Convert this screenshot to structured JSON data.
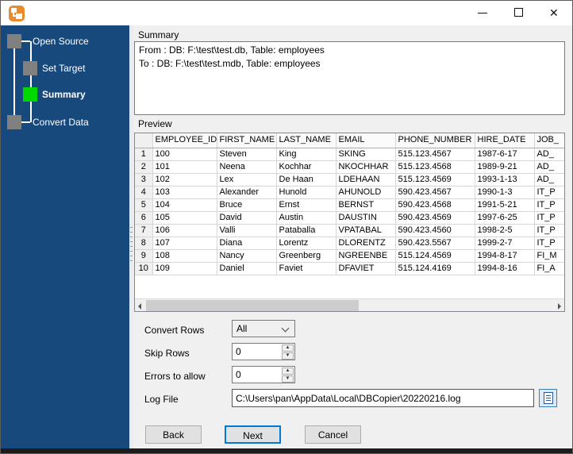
{
  "window": {
    "app_icon": "dbcopier-logo",
    "controls": {
      "minimize": "minimize",
      "maximize": "maximize",
      "close": "close"
    }
  },
  "sidebar": {
    "steps": [
      {
        "label": "Open Source",
        "state": "done"
      },
      {
        "label": "Set Target",
        "state": "done"
      },
      {
        "label": "Summary",
        "state": "active"
      },
      {
        "label": "Convert Data",
        "state": "pending"
      }
    ]
  },
  "main": {
    "summary": {
      "label": "Summary",
      "lines": [
        "From : DB: F:\\test\\test.db, Table: employees",
        "To : DB: F:\\test\\test.mdb, Table: employees"
      ]
    },
    "preview": {
      "label": "Preview",
      "columns": [
        "",
        "EMPLOYEE_ID",
        "FIRST_NAME",
        "LAST_NAME",
        "EMAIL",
        "PHONE_NUMBER",
        "HIRE_DATE",
        "JOB_"
      ],
      "rows": [
        [
          "1",
          "100",
          "Steven",
          "King",
          "SKING",
          "515.123.4567",
          "1987-6-17",
          "AD_"
        ],
        [
          "2",
          "101",
          "Neena",
          "Kochhar",
          "NKOCHHAR",
          "515.123.4568",
          "1989-9-21",
          "AD_"
        ],
        [
          "3",
          "102",
          "Lex",
          "De Haan",
          "LDEHAAN",
          "515.123.4569",
          "1993-1-13",
          "AD_"
        ],
        [
          "4",
          "103",
          "Alexander",
          "Hunold",
          "AHUNOLD",
          "590.423.4567",
          "1990-1-3",
          "IT_P"
        ],
        [
          "5",
          "104",
          "Bruce",
          "Ernst",
          "BERNST",
          "590.423.4568",
          "1991-5-21",
          "IT_P"
        ],
        [
          "6",
          "105",
          "David",
          "Austin",
          "DAUSTIN",
          "590.423.4569",
          "1997-6-25",
          "IT_P"
        ],
        [
          "7",
          "106",
          "Valli",
          "Pataballa",
          "VPATABAL",
          "590.423.4560",
          "1998-2-5",
          "IT_P"
        ],
        [
          "8",
          "107",
          "Diana",
          "Lorentz",
          "DLORENTZ",
          "590.423.5567",
          "1999-2-7",
          "IT_P"
        ],
        [
          "9",
          "108",
          "Nancy",
          "Greenberg",
          "NGREENBE",
          "515.124.4569",
          "1994-8-17",
          "FI_M"
        ],
        [
          "10",
          "109",
          "Daniel",
          "Faviet",
          "DFAVIET",
          "515.124.4169",
          "1994-8-16",
          "FI_A"
        ]
      ]
    },
    "form": {
      "convert_rows": {
        "label": "Convert Rows",
        "value": "All"
      },
      "skip_rows": {
        "label": "Skip Rows",
        "value": "0"
      },
      "errors_to_allow": {
        "label": "Errors to allow",
        "value": "0"
      },
      "log_file": {
        "label": "Log File",
        "value": "C:\\Users\\pan\\AppData\\Local\\DBCopier\\20220216.log"
      }
    },
    "buttons": {
      "back": "Back",
      "next": "Next",
      "cancel": "Cancel"
    }
  },
  "colors": {
    "sidebar_blue": "#17497D",
    "active_step_green": "#00D800",
    "inactive_step_gray": "#808080",
    "accent_blue": "#0078D7"
  }
}
